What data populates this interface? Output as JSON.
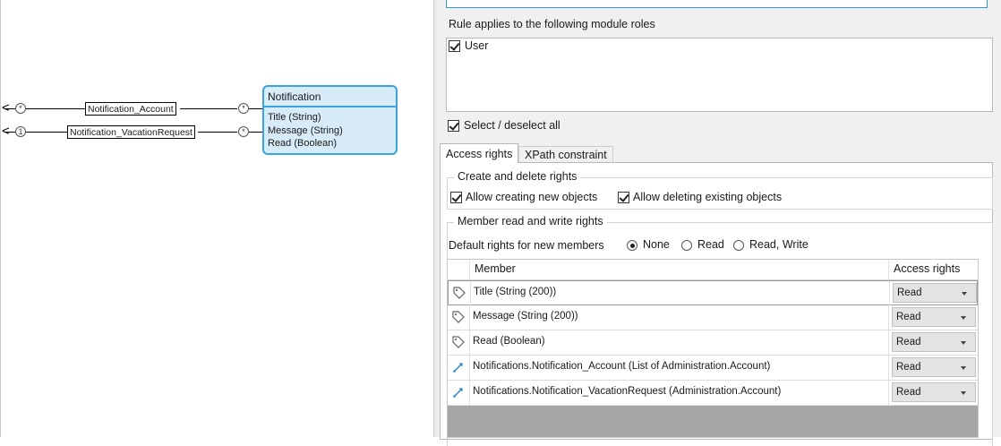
{
  "diagram": {
    "entity": {
      "name": "Notification",
      "attributes": [
        "Title (String)",
        "Message (String)",
        "Read (Boolean)"
      ]
    },
    "associations": [
      {
        "label": "Notification_Account",
        "left_multiplicity": "*",
        "right_multiplicity": "*"
      },
      {
        "label": "Notification_VacationRequest",
        "left_multiplicity": "1",
        "right_multiplicity": "*"
      }
    ]
  },
  "panel": {
    "roles_title": "Rule applies to the following module roles",
    "roles": [
      {
        "label": "User",
        "checked": true
      }
    ],
    "select_all_label": "Select / deselect all",
    "tabs": [
      {
        "label": "Access rights",
        "active": true
      },
      {
        "label": "XPath constraint",
        "active": false
      }
    ],
    "create_delete": {
      "title": "Create and delete rights",
      "allow_create_label": "Allow creating new objects",
      "allow_delete_label": "Allow deleting existing objects"
    },
    "member_rights": {
      "title": "Member read and write rights",
      "default_label": "Default rights for new members",
      "options": [
        "None",
        "Read",
        "Read, Write"
      ],
      "selected_option": "None",
      "columns": [
        "Member",
        "Access rights"
      ],
      "rows": [
        {
          "icon": "attribute-tag-icon",
          "member": "Title (String (200))",
          "rights": "Read"
        },
        {
          "icon": "attribute-tag-icon",
          "member": "Message (String (200))",
          "rights": "Read"
        },
        {
          "icon": "attribute-tag-icon",
          "member": "Read (Boolean)",
          "rights": "Read"
        },
        {
          "icon": "association-icon",
          "member": "Notifications.Notification_Account (List of Administration.Account)",
          "rights": "Read"
        },
        {
          "icon": "association-icon",
          "member": "Notifications.Notification_VacationRequest (Administration.Account)",
          "rights": "Read"
        }
      ]
    }
  },
  "colors": {
    "entity_border": "#3ba4e0",
    "entity_fill": "#d7ebf8",
    "focus_border": "#2d9bd1",
    "panel_bg": "#f0f0f0",
    "grid_empty_bg": "#a5a5a5"
  }
}
